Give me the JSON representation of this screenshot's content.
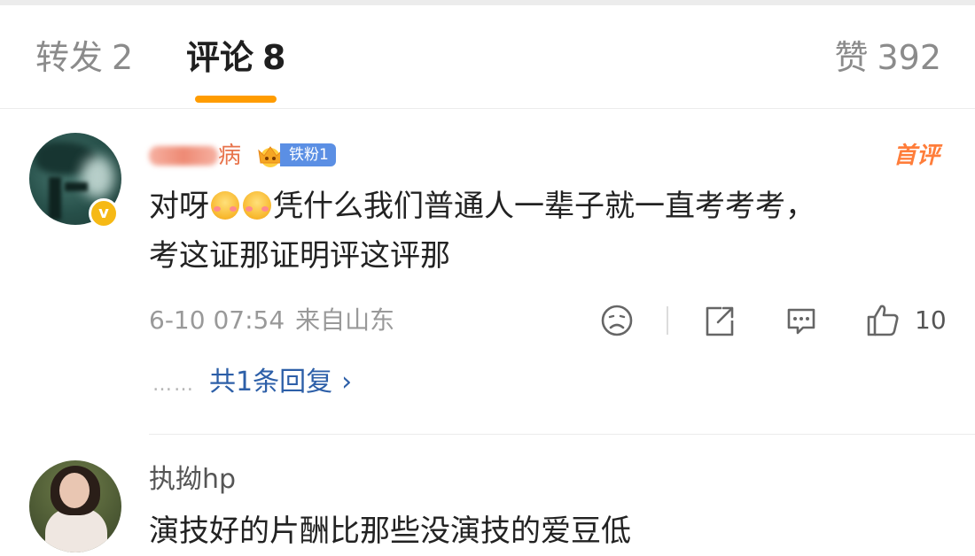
{
  "tabs": {
    "repost": {
      "label": "转发",
      "count": "2"
    },
    "comments": {
      "label": "评论",
      "count": "8"
    },
    "likes": {
      "label": "赞",
      "count": "392"
    }
  },
  "comments": [
    {
      "username_visible": "病",
      "fan_badge": "铁粉1",
      "first_comment_tag": "首评",
      "text_line1_a": "对呀",
      "text_line1_b": "凭什么我们普通人一辈子就一直考考考，",
      "text_line2": "考这证那证明评这评那",
      "time": "6-10 07:54",
      "location": "来自山东",
      "likes": "10",
      "replies_dots": "……",
      "replies_link": "共1条回复",
      "verified_mark": "v"
    },
    {
      "username": "执拗hp",
      "text": "演技好的片酬比那些没演技的爱豆低"
    }
  ],
  "colors": {
    "accent_underline": "#ff9c00",
    "first_comment_tag": "#ff7d3a",
    "fan_badge": "#5b8fe4",
    "reply_link": "#2d5fa8",
    "verified_badge": "#f6b915"
  },
  "icons": [
    "crown-icon",
    "emoji-icon",
    "dislike-icon",
    "share-icon",
    "comment-icon",
    "like-icon",
    "chevron-right-icon"
  ]
}
